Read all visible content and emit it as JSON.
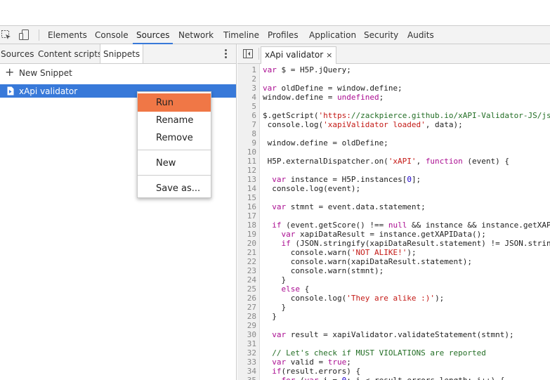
{
  "toolbar": {
    "tabs": [
      {
        "label": "Elements"
      },
      {
        "label": "Console"
      },
      {
        "label": "Sources"
      },
      {
        "label": "Network"
      },
      {
        "label": "Timeline"
      },
      {
        "label": "Profiles"
      },
      {
        "label": "Application"
      },
      {
        "label": "Security"
      },
      {
        "label": "Audits"
      }
    ],
    "active_tab": "Sources"
  },
  "navigator": {
    "tabs": [
      {
        "label": "Sources"
      },
      {
        "label": "Content scripts"
      },
      {
        "label": "Snippets"
      }
    ],
    "active_tab": "Snippets",
    "new_snippet_label": "New Snippet",
    "snippets": [
      {
        "label": "xApi validator"
      }
    ]
  },
  "editor": {
    "file_tab_label": "xApi validator",
    "close_glyph": "×",
    "lines": [
      {
        "n": "1",
        "text": "var $ = H5P.jQuery;"
      },
      {
        "n": "2",
        "text": ""
      },
      {
        "n": "3",
        "text": "var oldDefine = window.define;"
      },
      {
        "n": "4",
        "text": "window.define = undefined;"
      },
      {
        "n": "5",
        "text": ""
      },
      {
        "n": "6",
        "text": "$.getScript('https://zackpierce.github.io/xAPI-Validator-JS/js"
      },
      {
        "n": "7",
        "text": " console.log('xapiValidator loaded', data);"
      },
      {
        "n": "8",
        "text": ""
      },
      {
        "n": "9",
        "text": " window.define = oldDefine;"
      },
      {
        "n": "10",
        "text": ""
      },
      {
        "n": "11",
        "text": " H5P.externalDispatcher.on('xAPI', function (event) {"
      },
      {
        "n": "12",
        "text": ""
      },
      {
        "n": "13",
        "text": "  var instance = H5P.instances[0];"
      },
      {
        "n": "14",
        "text": "  console.log(event);"
      },
      {
        "n": "15",
        "text": ""
      },
      {
        "n": "16",
        "text": "  var stmnt = event.data.statement;"
      },
      {
        "n": "17",
        "text": ""
      },
      {
        "n": "18",
        "text": "  if (event.getScore() !== null && instance && instance.getXAP"
      },
      {
        "n": "19",
        "text": "    var xapiDataResult = instance.getXAPIData();"
      },
      {
        "n": "20",
        "text": "    if (JSON.stringify(xapiDataResult.statement) != JSON.strin"
      },
      {
        "n": "21",
        "text": "      console.warn('NOT ALIKE!');"
      },
      {
        "n": "22",
        "text": "      console.warn(xapiDataResult.statement);"
      },
      {
        "n": "23",
        "text": "      console.warn(stmnt);"
      },
      {
        "n": "24",
        "text": "    }"
      },
      {
        "n": "25",
        "text": "    else {"
      },
      {
        "n": "26",
        "text": "      console.log('They are alike :)');"
      },
      {
        "n": "27",
        "text": "    }"
      },
      {
        "n": "28",
        "text": "  }"
      },
      {
        "n": "29",
        "text": ""
      },
      {
        "n": "30",
        "text": "  var result = xapiValidator.validateStatement(stmnt);"
      },
      {
        "n": "31",
        "text": ""
      },
      {
        "n": "32",
        "text": "  // Let's check if MUST VIOLATIONS are reported"
      },
      {
        "n": "33",
        "text": "  var valid = true;"
      },
      {
        "n": "34",
        "text": "  if(result.errors) {"
      },
      {
        "n": "35",
        "text": "    for (var i = 0; i < result.errors.length; i++) {"
      }
    ]
  },
  "context_menu": {
    "items": [
      {
        "label": "Run"
      },
      {
        "label": "Rename"
      },
      {
        "label": "Remove"
      },
      {
        "label": "New"
      },
      {
        "label": "Save as..."
      }
    ],
    "selected": "Run"
  },
  "colors": {
    "accent_blue": "#3879d9",
    "menu_highlight": "#f07746",
    "string_red": "#c41a16",
    "keyword_purple": "#aa0d91",
    "number_blue": "#1c00cf",
    "comment_green": "#236e25"
  }
}
